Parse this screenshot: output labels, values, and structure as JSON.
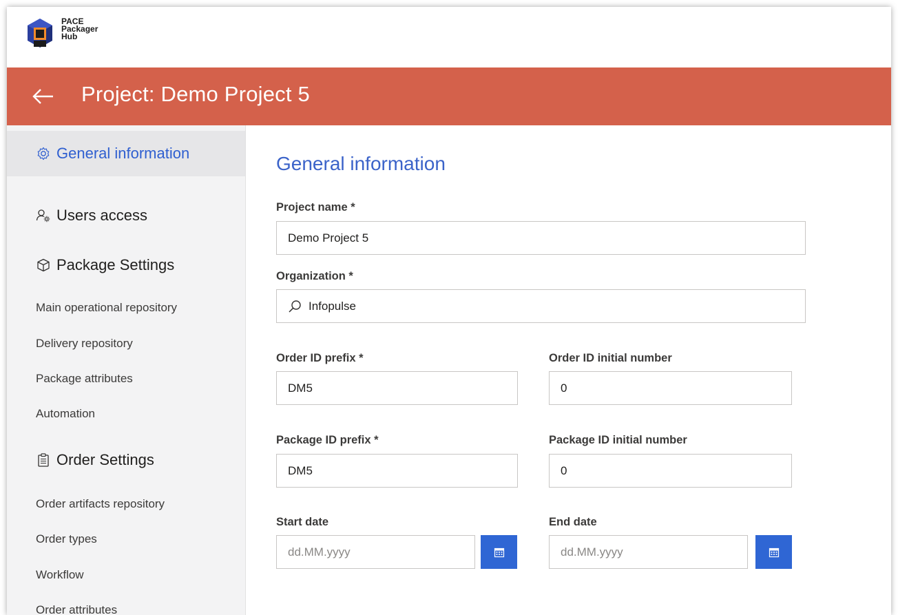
{
  "brand": {
    "line1": "PACE",
    "line2": "Packager",
    "line3": "Hub"
  },
  "header": {
    "title": "Project: Demo Project 5",
    "accent": "#d4614b"
  },
  "sidebar": {
    "general": "General information",
    "users": "Users access",
    "package_heading": "Package Settings",
    "package_items": [
      "Main operational repository",
      "Delivery repository",
      "Package attributes",
      "Automation"
    ],
    "order_heading": "Order Settings",
    "order_items": [
      "Order artifacts repository",
      "Order types",
      "Workflow",
      "Order attributes"
    ]
  },
  "form": {
    "title": "General information",
    "project_name_label": "Project name *",
    "project_name_value": "Demo Project 5",
    "organization_label": "Organization *",
    "organization_value": "Infopulse",
    "order_prefix_label": "Order ID prefix *",
    "order_prefix_value": "DM5",
    "order_initial_label": "Order ID initial number",
    "order_initial_value": "0",
    "package_prefix_label": "Package ID prefix *",
    "package_prefix_value": "DM5",
    "package_initial_label": "Package ID initial number",
    "package_initial_value": "0",
    "start_date_label": "Start date",
    "start_date_placeholder": "dd.MM.yyyy",
    "end_date_label": "End date",
    "end_date_placeholder": "dd.MM.yyyy"
  },
  "icons": {
    "back": "arrow-left-icon",
    "general": "gear-icon",
    "users": "user-settings-icon",
    "package": "package-box-icon",
    "order": "clipboard-icon",
    "search": "search-icon",
    "calendar": "calendar-icon"
  },
  "colors": {
    "link_blue": "#2f5fd0",
    "button_blue": "#2f66d4",
    "header_orange": "#d4614b"
  }
}
